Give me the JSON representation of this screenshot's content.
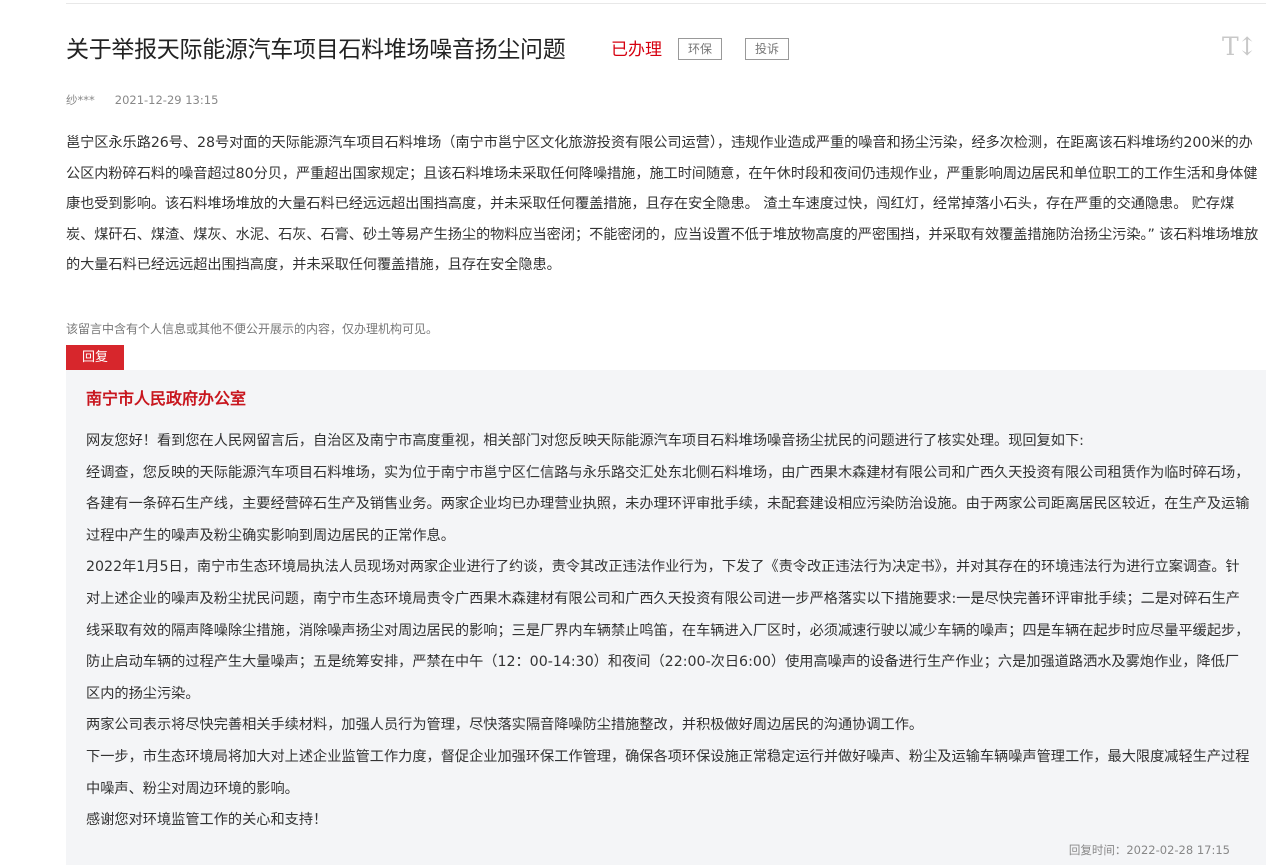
{
  "post": {
    "title": "关于举报天际能源汽车项目石料堆场噪音扬尘问题",
    "status": "已办理",
    "tags": [
      "环保",
      "投诉"
    ],
    "font_size_toggle": "T↕",
    "author": "纱***",
    "date": "2021-12-29 13:15",
    "content": "邕宁区永乐路26号、28号对面的天际能源汽车项目石料堆场（南宁市邕宁区文化旅游投资有限公司运营），违规作业造成严重的噪音和扬尘污染，经多次检测，在距离该石料堆场约200米的办公区内粉碎石料的噪音超过80分贝，严重超出国家规定；且该石料堆场未采取任何降噪措施，施工时间随意，在午休时段和夜间仍违规作业，严重影响周边居民和单位职工的工作生活和身体健康也受到影响。该石料堆场堆放的大量石料已经远远超出围挡高度，并未采取任何覆盖措施，且存在安全隐患。 渣土车速度过快，闯红灯，经常掉落小石头，存在严重的交通隐患。 贮存煤炭、煤矸石、煤渣、煤灰、水泥、石灰、石膏、砂土等易产生扬尘的物料应当密闭；不能密闭的，应当设置不低于堆放物高度的严密围挡，并采取有效覆盖措施防治扬尘污染。” 该石料堆场堆放的大量石料已经远远超出围挡高度，并未采取任何覆盖措施，且存在安全隐患。",
    "privacy_note": "该留言中含有个人信息或其他不便公开展示的内容，仅办理机构可见。"
  },
  "reply": {
    "tab_label": "回复",
    "org": "南宁市人民政府办公室",
    "paragraphs": [
      "网友您好！看到您在人民网留言后，自治区及南宁市高度重视，相关部门对您反映天际能源汽车项目石料堆场噪音扬尘扰民的问题进行了核实处理。现回复如下:",
      "经调查，您反映的天际能源汽车项目石料堆场，实为位于南宁市邕宁区仁信路与永乐路交汇处东北侧石料堆场，由广西果木森建材有限公司和广西久天投资有限公司租赁作为临时碎石场，各建有一条碎石生产线，主要经营碎石生产及销售业务。两家企业均已办理营业执照，未办理环评审批手续，未配套建设相应污染防治设施。由于两家公司距离居民区较近，在生产及运输过程中产生的噪声及粉尘确实影响到周边居民的正常作息。",
      "2022年1月5日，南宁市生态环境局执法人员现场对两家企业进行了约谈，责令其改正违法作业行为，下发了《责令改正违法行为决定书》，并对其存在的环境违法行为进行立案调查。针对上述企业的噪声及粉尘扰民问题，南宁市生态环境局责令广西果木森建材有限公司和广西久天投资有限公司进一步严格落实以下措施要求:一是尽快完善环评审批手续；二是对碎石生产线采取有效的隔声降噪除尘措施，消除噪声扬尘对周边居民的影响；三是厂界内车辆禁止鸣笛，在车辆进入厂区时，必须减速行驶以减少车辆的噪声；四是车辆在起步时应尽量平缓起步，防止启动车辆的过程产生大量噪声；五是统筹安排，严禁在中午（12：00-14:30）和夜间（22:00-次日6:00）使用高噪声的设备进行生产作业；六是加强道路洒水及雾炮作业，降低厂区内的扬尘污染。",
      "两家公司表示将尽快完善相关手续材料，加强人员行为管理，尽快落实隔音降噪防尘措施整改，并积极做好周边居民的沟通协调工作。",
      "下一步，市生态环境局将加大对上述企业监管工作力度，督促企业加强环保工作管理，确保各项环保设施正常稳定运行并做好噪声、粉尘及运输车辆噪声管理工作，最大限度减轻生产过程中噪声、粉尘对周边环境的影响。",
      "感谢您对环境监管工作的关心和支持！"
    ],
    "time_label": "回复时间：",
    "time": "2022-02-28 17:15"
  }
}
